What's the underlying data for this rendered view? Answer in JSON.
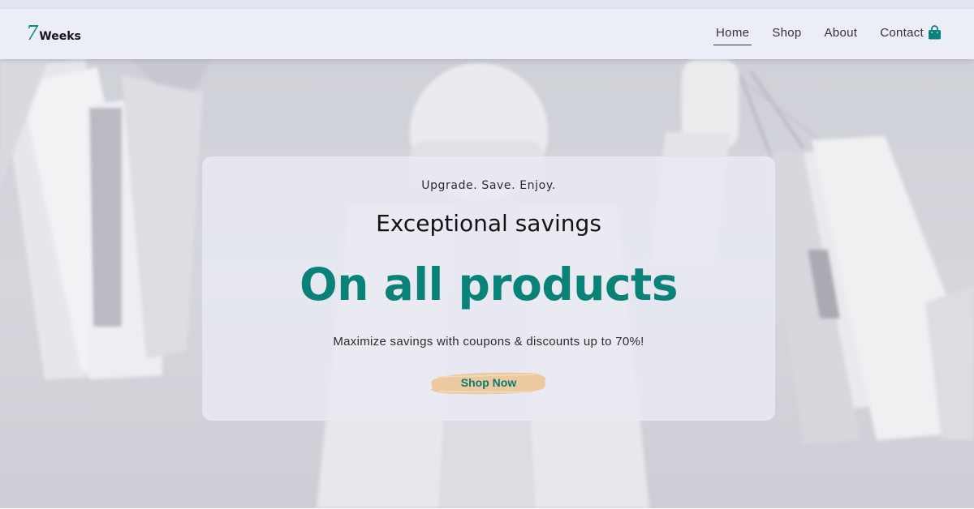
{
  "brand": {
    "logo_mark": "7",
    "logo_text": "Weeks"
  },
  "nav": {
    "items": [
      {
        "label": "Home",
        "active": true
      },
      {
        "label": "Shop",
        "active": false
      },
      {
        "label": "About",
        "active": false
      },
      {
        "label": "Contact",
        "active": false
      }
    ],
    "cart_icon": "shopping-bag-icon"
  },
  "hero": {
    "tagline": "Upgrade. Save. Enjoy.",
    "headline": "Exceptional savings",
    "big_line": "On all products",
    "subline": "Maximize savings with coupons & discounts up to 70%!",
    "cta_label": "Shop Now"
  },
  "colors": {
    "accent": "#0b8277",
    "cta_brush": "#ecc9a0",
    "nav_background": "#eceef7"
  }
}
